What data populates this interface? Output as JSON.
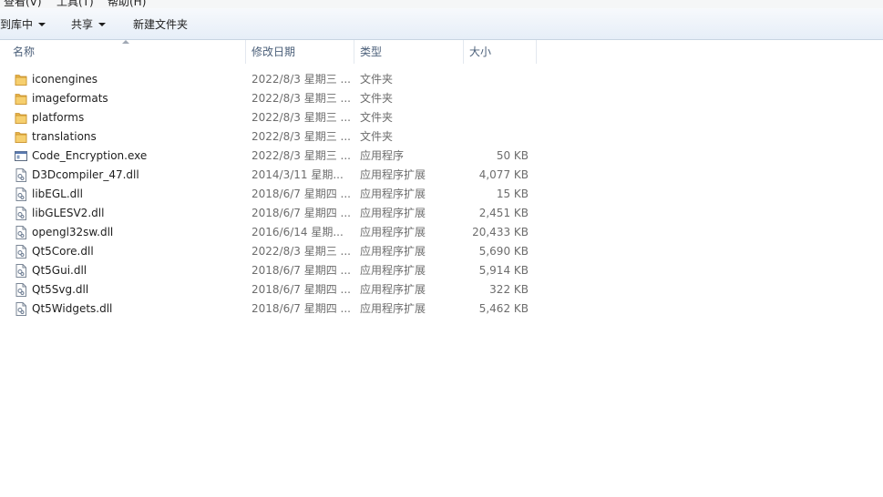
{
  "menubar": {
    "items": [
      "查看(V)",
      "工具(T)",
      "帮助(H)"
    ]
  },
  "toolbar": {
    "include_library": "到库中",
    "share": "共享",
    "new_folder": "新建文件夹"
  },
  "columns": {
    "name": "名称",
    "date": "修改日期",
    "type": "类型",
    "size": "大小"
  },
  "files": [
    {
      "icon": "folder-icon",
      "name": "iconengines",
      "date": "2022/8/3 星期三 ...",
      "type": "文件夹",
      "size": ""
    },
    {
      "icon": "folder-icon",
      "name": "imageformats",
      "date": "2022/8/3 星期三 ...",
      "type": "文件夹",
      "size": ""
    },
    {
      "icon": "folder-icon",
      "name": "platforms",
      "date": "2022/8/3 星期三 ...",
      "type": "文件夹",
      "size": ""
    },
    {
      "icon": "folder-icon",
      "name": "translations",
      "date": "2022/8/3 星期三 ...",
      "type": "文件夹",
      "size": ""
    },
    {
      "icon": "exe-icon",
      "name": "Code_Encryption.exe",
      "date": "2022/8/3 星期三 ...",
      "type": "应用程序",
      "size": "50 KB"
    },
    {
      "icon": "dll-icon",
      "name": "D3Dcompiler_47.dll",
      "date": "2014/3/11 星期...",
      "type": "应用程序扩展",
      "size": "4,077 KB"
    },
    {
      "icon": "dll-icon",
      "name": "libEGL.dll",
      "date": "2018/6/7 星期四 ...",
      "type": "应用程序扩展",
      "size": "15 KB"
    },
    {
      "icon": "dll-icon",
      "name": "libGLESV2.dll",
      "date": "2018/6/7 星期四 ...",
      "type": "应用程序扩展",
      "size": "2,451 KB"
    },
    {
      "icon": "dll-icon",
      "name": "opengl32sw.dll",
      "date": "2016/6/14 星期...",
      "type": "应用程序扩展",
      "size": "20,433 KB"
    },
    {
      "icon": "dll-icon",
      "name": "Qt5Core.dll",
      "date": "2022/8/3 星期三 ...",
      "type": "应用程序扩展",
      "size": "5,690 KB"
    },
    {
      "icon": "dll-icon",
      "name": "Qt5Gui.dll",
      "date": "2018/6/7 星期四 ...",
      "type": "应用程序扩展",
      "size": "5,914 KB"
    },
    {
      "icon": "dll-icon",
      "name": "Qt5Svg.dll",
      "date": "2018/6/7 星期四 ...",
      "type": "应用程序扩展",
      "size": "322 KB"
    },
    {
      "icon": "dll-icon",
      "name": "Qt5Widgets.dll",
      "date": "2018/6/7 星期四 ...",
      "type": "应用程序扩展",
      "size": "5,462 KB"
    }
  ]
}
